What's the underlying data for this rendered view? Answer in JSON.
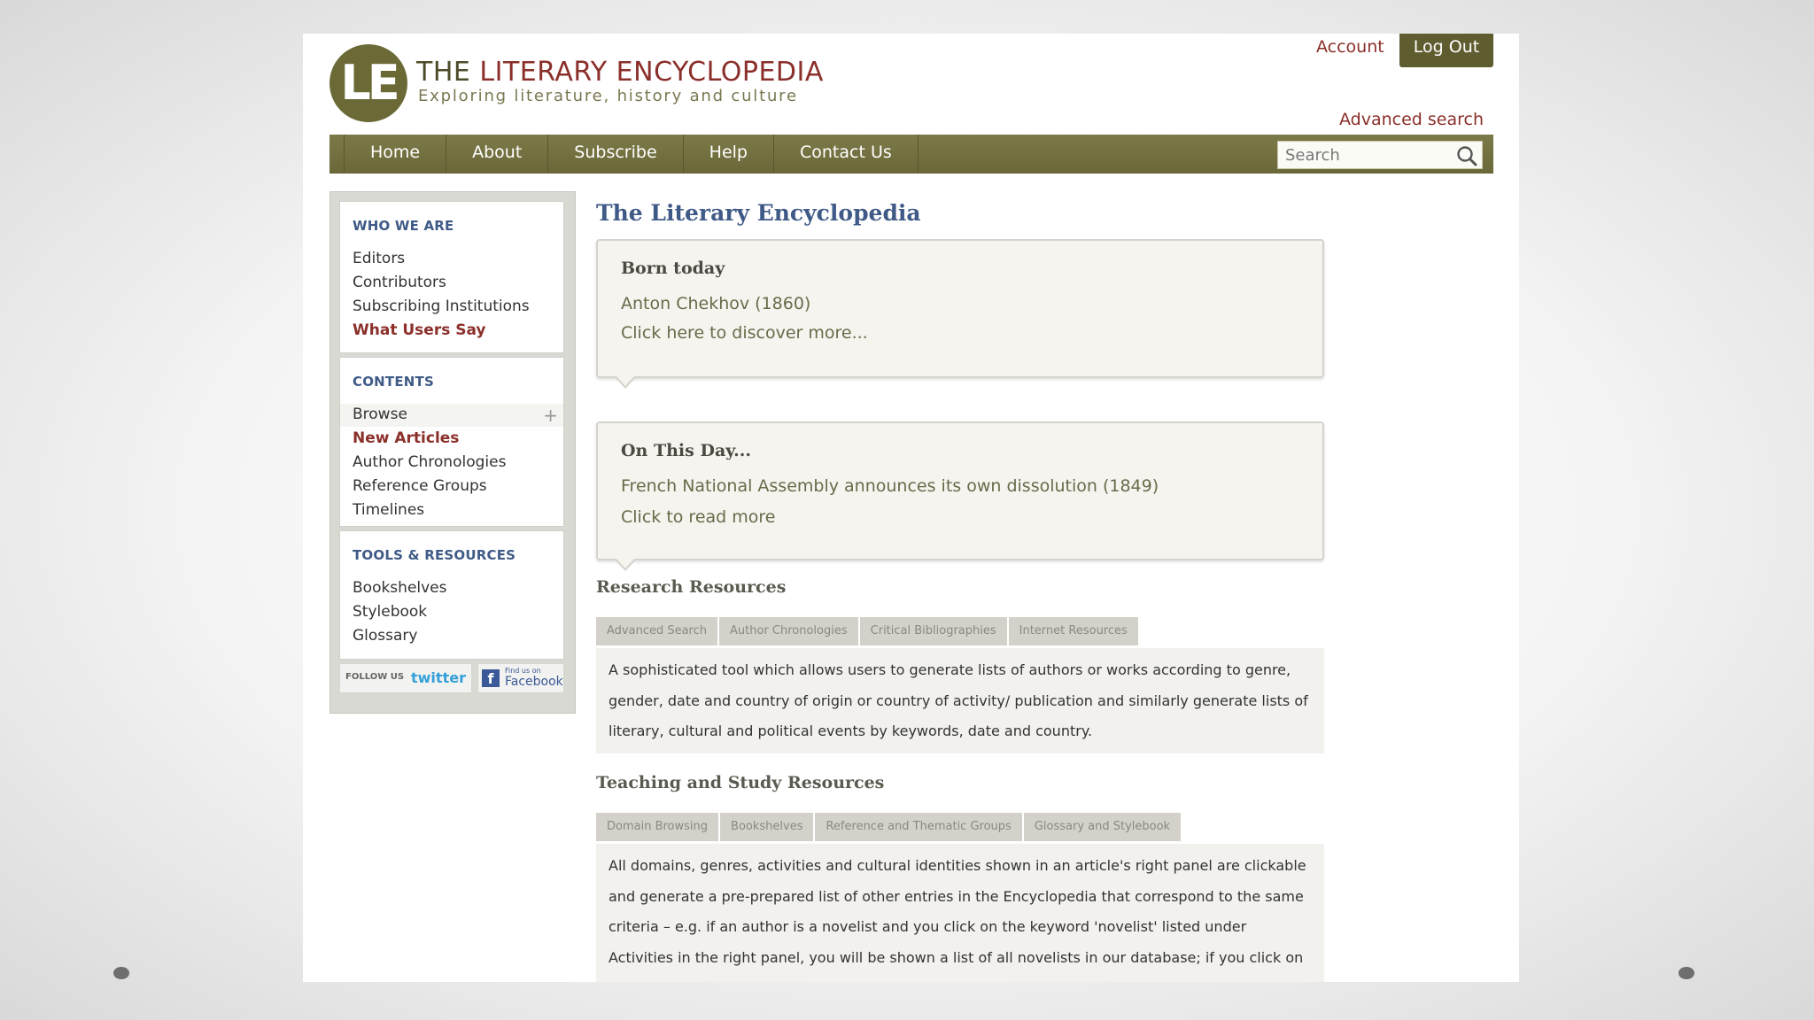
{
  "header": {
    "logo_text": "LE",
    "title_the": "THE",
    "title_rest": "LITERARY ENCYCLOPEDIA",
    "tagline": "Exploring literature, history and culture",
    "account_label": "Account",
    "logout_label": "Log Out",
    "advanced_search_label": "Advanced search"
  },
  "nav": {
    "items": [
      "Home",
      "About",
      "Subscribe",
      "Help",
      "Contact Us"
    ],
    "search_placeholder": "Search"
  },
  "sidebar": {
    "who_we_are": {
      "heading": "WHO WE ARE",
      "links": [
        "Editors",
        "Contributors",
        "Subscribing Institutions",
        "What Users Say"
      ]
    },
    "contents": {
      "heading": "CONTENTS",
      "links": [
        "Browse",
        "New Articles",
        "Author Chronologies",
        "Reference Groups",
        "Timelines"
      ]
    },
    "tools": {
      "heading": "TOOLS & RESOURCES",
      "links": [
        "Bookshelves",
        "Stylebook",
        "Glossary"
      ]
    },
    "social": {
      "follow_label": "FOLLOW US",
      "twitter_label": "twitter",
      "facebook_small": "Find us on",
      "facebook_label": "Facebook"
    }
  },
  "main": {
    "title": "The Literary Encyclopedia",
    "born_today": {
      "heading": "Born today",
      "line1": "Anton Chekhov (1860)",
      "line2": "Click here to discover more..."
    },
    "on_this_day": {
      "heading": "On This Day...",
      "line1": "French National Assembly announces its own dissolution (1849)",
      "line2": "Click to read more"
    },
    "research": {
      "heading": "Research Resources",
      "tabs": [
        "Advanced Search",
        "Author Chronologies",
        "Critical Bibliographies",
        "Internet Resources"
      ],
      "text": "A sophisticated tool which allows users to generate lists of authors or works according to genre, gender, date and country of origin or country of activity/ publication and similarly generate lists of literary, cultural and political events by keywords, date and country."
    },
    "teaching": {
      "heading": "Teaching and Study Resources",
      "tabs": [
        "Domain Browsing",
        "Bookshelves",
        "Reference and Thematic Groups",
        "Glossary and Stylebook"
      ],
      "text": "All domains, genres, activities and cultural identities shown in an article's right panel are clickable and generate a pre-prepared list of other entries in the Encyclopedia that correspond to the same criteria – e.g. if an author is a novelist and you click on the keyword 'novelist' listed under Activities in the right panel, you will be shown a list of all novelists in our database; if you click on African American under Cultural Identities, you will be presented with a list of all our relevant"
    }
  },
  "colors": {
    "olive": "#6b6a37",
    "maroon": "#8b2f2a",
    "blue_heading": "#3f5a87"
  }
}
